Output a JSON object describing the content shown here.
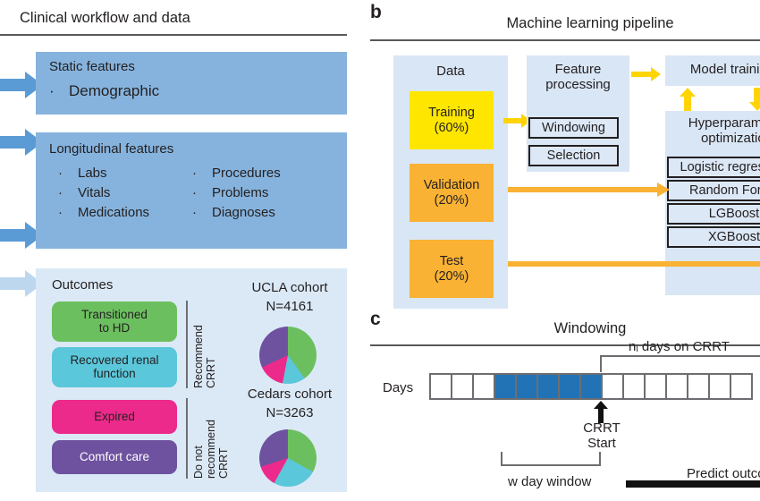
{
  "panel_a": {
    "letter": "",
    "title": "Clinical workflow and data",
    "static_features": {
      "heading": "Static features",
      "bullets": [
        "Demographic"
      ]
    },
    "longitudinal_features": {
      "heading": "Longitudinal features",
      "bullets_left": [
        "Labs",
        "Vitals",
        "Medications"
      ],
      "bullets_right": [
        "Procedures",
        "Problems",
        "Diagnoses"
      ]
    },
    "outcomes": {
      "heading": "Outcomes",
      "pills": [
        {
          "label": "Transitioned\nto HD",
          "color": "#6cbf5f",
          "text_color": "#231f20"
        },
        {
          "label": "Recovered renal\nfunction",
          "color": "#5bc7da",
          "text_color": "#231f20"
        },
        {
          "label": "Expired",
          "color": "#ec2a8b",
          "text_color": "#231f20"
        },
        {
          "label": "Comfort care",
          "color": "#6e529f",
          "text_color": "#ffffff"
        }
      ],
      "recommend_label": "Recommend\nCRRT",
      "do_not_recommend_label": "Do not\nrecommend\nCRRT",
      "cohorts": [
        {
          "name": "UCLA cohort",
          "n_label": "N=4161"
        },
        {
          "name": "Cedars cohort",
          "n_label": "N=3263"
        }
      ]
    }
  },
  "panel_b": {
    "letter": "b",
    "title": "Machine learning pipeline",
    "data_group": {
      "heading": "Data",
      "splits": [
        {
          "label": "Training\n(60%)",
          "color": "#ffe600"
        },
        {
          "label": "Validation\n(20%)",
          "color": "#f9b233"
        },
        {
          "label": "Test\n(20%)",
          "color": "#f9b233"
        }
      ]
    },
    "feature_processing": {
      "heading": "Feature\nprocessing",
      "steps": [
        "Windowing",
        "Selection"
      ]
    },
    "model_training": {
      "heading": "Model training"
    },
    "hyperparameter": {
      "heading": "Hyperparameter\noptimization",
      "models": [
        "Logistic regression",
        "Random Forest",
        "LGBoost",
        "XGBoost"
      ]
    }
  },
  "panel_c": {
    "letter": "c",
    "title": "Windowing",
    "days_label": "Days",
    "crrt_start_label": "CRRT\nStart",
    "window_label": "w day window",
    "ni_days_label": "nᵢ days on CRRT",
    "predict_label": "Predict outcome",
    "day_cells": [
      {
        "filled": false
      },
      {
        "filled": false
      },
      {
        "filled": false
      },
      {
        "filled": true
      },
      {
        "filled": true
      },
      {
        "filled": true
      },
      {
        "filled": true
      },
      {
        "filled": true
      },
      {
        "filled": false
      },
      {
        "filled": false
      },
      {
        "filled": false
      },
      {
        "filled": false
      },
      {
        "filled": false
      },
      {
        "filled": false
      },
      {
        "filled": false
      }
    ]
  },
  "chart_data": [
    {
      "type": "pie",
      "title": "UCLA cohort",
      "subtitle": "N=4161",
      "categories": [
        "Transitioned to HD",
        "Recovered renal function",
        "Expired",
        "Comfort care"
      ],
      "values": [
        40,
        13,
        15,
        32
      ],
      "colors": [
        "#6cbf5f",
        "#5bc7da",
        "#ec2a8b",
        "#6e529f"
      ],
      "legend": "off"
    },
    {
      "type": "pie",
      "title": "Cedars cohort",
      "subtitle": "N=3263",
      "categories": [
        "Transitioned to HD",
        "Recovered renal function",
        "Expired",
        "Comfort care"
      ],
      "values": [
        33,
        25,
        12,
        30
      ],
      "colors": [
        "#6cbf5f",
        "#5bc7da",
        "#ec2a8b",
        "#6e529f"
      ],
      "legend": "off"
    }
  ],
  "colors": {
    "panel_a_box": "#86b3dd",
    "panel_a_light": "#dbe9f6",
    "arrow_blue": "#5b9bd5",
    "training_yellow": "#ffe600",
    "split_orange": "#f9b233",
    "group_bg": "#d9e6f5",
    "window_blue": "#2273b5",
    "rule_gray": "#58595b"
  }
}
